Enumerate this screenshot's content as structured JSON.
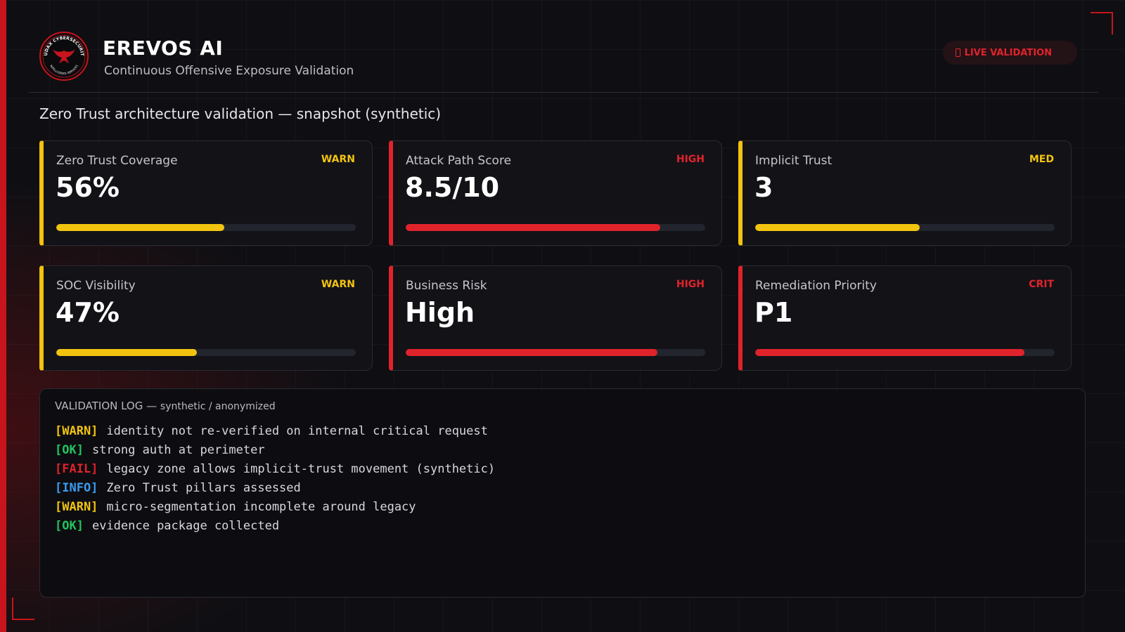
{
  "colors": {
    "accent": "#c8141c",
    "warn": "#f2c30f",
    "high": "#e0232b",
    "ok": "#22c55e",
    "info": "#3b9bf0",
    "background": "#0f0f13"
  },
  "header": {
    "logo_icon": "audax-cybersecurity-eagle-seal",
    "logo_text_top": "AUDAX CYBERSECURITY",
    "logo_text_bottom": "INTELLIGENCE SERVICES",
    "title": "EREVOS AI",
    "subtitle": "Continuous Offensive Exposure Validation",
    "status_pill": {
      "icon": "live-icon",
      "label": "LIVE VALIDATION"
    }
  },
  "section_title": "Zero Trust architecture validation — snapshot (synthetic)",
  "metrics": [
    {
      "label": "Zero Trust Coverage",
      "value": "56%",
      "badge": "WARN",
      "level": 0.56,
      "tone": "warn"
    },
    {
      "label": "Attack Path Score",
      "value": "8.5/10",
      "badge": "HIGH",
      "level": 0.85,
      "tone": "high"
    },
    {
      "label": "Implicit Trust",
      "value": "3",
      "badge": "MED",
      "level": 0.55,
      "tone": "warn"
    },
    {
      "label": "SOC Visibility",
      "value": "47%",
      "badge": "WARN",
      "level": 0.47,
      "tone": "warn"
    },
    {
      "label": "Business Risk",
      "value": "High",
      "badge": "HIGH",
      "level": 0.84,
      "tone": "high"
    },
    {
      "label": "Remediation Priority",
      "value": "P1",
      "badge": "CRIT",
      "level": 0.9,
      "tone": "high"
    }
  ],
  "log": {
    "title": "VALIDATION LOG —",
    "subtitle": "synthetic / anonymized",
    "entries": [
      {
        "tag": "[WARN]",
        "level": "warn",
        "text": "identity not re-verified on internal critical request"
      },
      {
        "tag": "[OK]",
        "level": "ok",
        "text": "strong auth at perimeter"
      },
      {
        "tag": "[FAIL]",
        "level": "fail",
        "text": "legacy zone allows implicit-trust movement (synthetic)"
      },
      {
        "tag": "[INFO]",
        "level": "info",
        "text": "Zero Trust pillars assessed"
      },
      {
        "tag": "[WARN]",
        "level": "warn",
        "text": "micro-segmentation incomplete around legacy"
      },
      {
        "tag": "[OK]",
        "level": "ok",
        "text": "evidence package collected"
      }
    ]
  }
}
